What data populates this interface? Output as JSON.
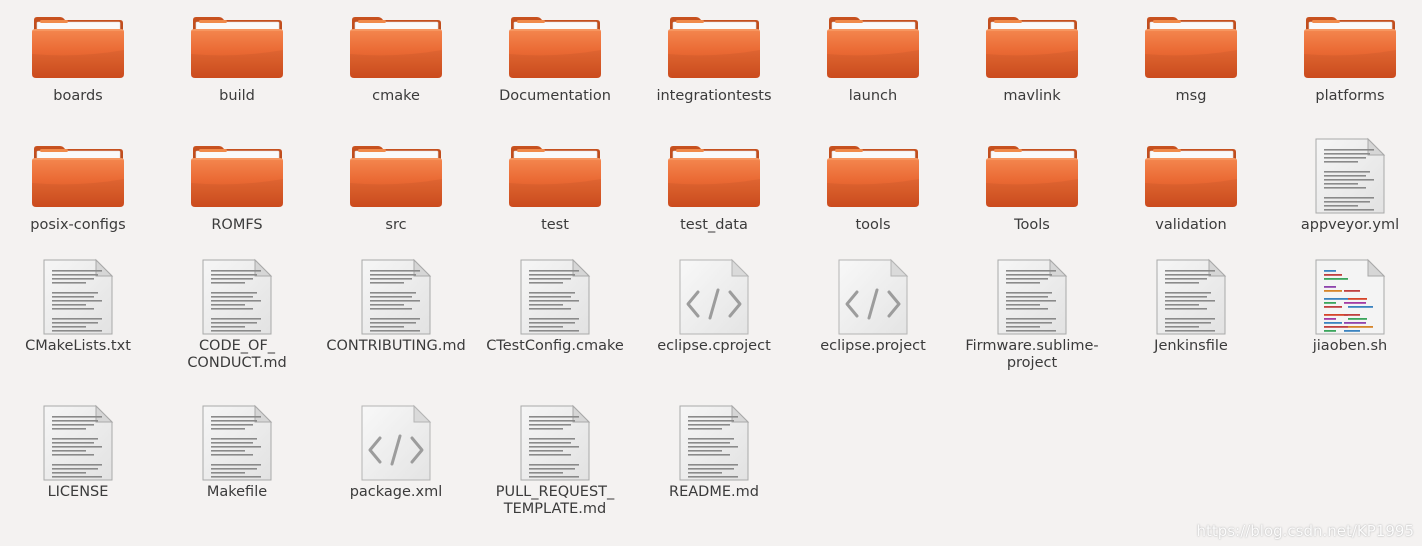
{
  "items": [
    {
      "name": "boards",
      "type": "folder"
    },
    {
      "name": "build",
      "type": "folder"
    },
    {
      "name": "cmake",
      "type": "folder"
    },
    {
      "name": "Documentation",
      "type": "folder"
    },
    {
      "name": "integrationtests",
      "type": "folder"
    },
    {
      "name": "launch",
      "type": "folder"
    },
    {
      "name": "mavlink",
      "type": "folder"
    },
    {
      "name": "msg",
      "type": "folder"
    },
    {
      "name": "platforms",
      "type": "folder"
    },
    {
      "name": "posix-configs",
      "type": "folder"
    },
    {
      "name": "ROMFS",
      "type": "folder"
    },
    {
      "name": "src",
      "type": "folder"
    },
    {
      "name": "test",
      "type": "folder"
    },
    {
      "name": "test_data",
      "type": "folder"
    },
    {
      "name": "tools",
      "type": "folder"
    },
    {
      "name": "Tools",
      "type": "folder"
    },
    {
      "name": "validation",
      "type": "folder"
    },
    {
      "name": "appveyor.yml",
      "type": "text-file"
    },
    {
      "name": "CMakeLists.txt",
      "type": "text-file"
    },
    {
      "name": "CODE_OF_\nCONDUCT.md",
      "type": "text-file"
    },
    {
      "name": "CONTRIBUTING.md",
      "type": "text-file"
    },
    {
      "name": "CTestConfig.cmake",
      "type": "text-file"
    },
    {
      "name": "eclipse.cproject",
      "type": "markup-file"
    },
    {
      "name": "eclipse.project",
      "type": "markup-file"
    },
    {
      "name": "Firmware.sublime-\nproject",
      "type": "text-file"
    },
    {
      "name": "Jenkinsfile",
      "type": "text-file"
    },
    {
      "name": "jiaoben.sh",
      "type": "script-file"
    },
    {
      "name": "LICENSE",
      "type": "text-file"
    },
    {
      "name": "Makefile",
      "type": "text-file"
    },
    {
      "name": "package.xml",
      "type": "markup-file"
    },
    {
      "name": "PULL_REQUEST_\nTEMPLATE.md",
      "type": "text-file"
    },
    {
      "name": "README.md",
      "type": "text-file"
    }
  ],
  "watermark": "https://blog.csdn.net/KP1995",
  "colors": {
    "folder_front": "#e8602c",
    "folder_back": "#d65a28",
    "background": "#f4f2f1"
  }
}
